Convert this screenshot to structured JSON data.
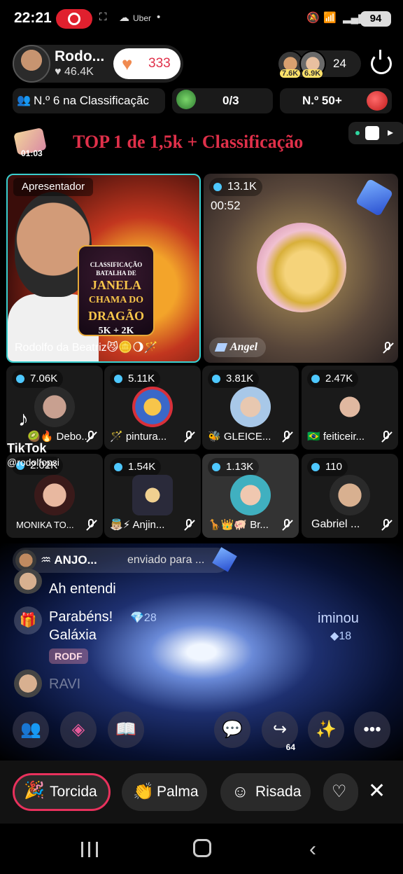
{
  "status": {
    "time": "22:21",
    "carrier_label": "Uber",
    "battery": "94"
  },
  "host": {
    "name": "Rodo...",
    "likes": "46.4K",
    "follow_count": "333"
  },
  "viewers": {
    "badge1": "7.6K",
    "badge2": "6.9K",
    "count": "24"
  },
  "ranking": {
    "rank_label": "N.º 6 na Classificaçãc",
    "progress": "0/3",
    "rank2_label": "N.º 50+"
  },
  "banner": {
    "timer": "01:03",
    "title": "TOP 1 de 1,5k + Classificação"
  },
  "host_tile": {
    "role": "Apresentador",
    "poster_small": "CLASSIFICAÇÃO",
    "poster_l1": "BATALHA DE",
    "poster_l2": "JANELA",
    "poster_l3": "CHAMA DO",
    "poster_l4": "DRAGÃO",
    "poster_l5": "5K + 2K",
    "label": "Rodolfo da Beatriz😼🪙🌖🪄"
  },
  "guest_tile": {
    "views": "13.1K",
    "timer": "00:52",
    "label": "Angel"
  },
  "small_tiles": [
    {
      "views": "7.06K",
      "name": "🥝🔥 Debo..."
    },
    {
      "views": "5.11K",
      "name": "🪄 pintura..."
    },
    {
      "views": "3.81K",
      "name": "🐝 GLEICE..."
    },
    {
      "views": "2.47K",
      "name": "🇧🇷 feiticeir..."
    },
    {
      "views": "2.02K",
      "name": "MONIKA TO..."
    },
    {
      "views": "1.54K",
      "name": "👼🏼⚡ Anjin..."
    },
    {
      "views": "1.13K",
      "name": "🦒👑🐖 Br..."
    },
    {
      "views": "110",
      "name": "Gabriel ..."
    }
  ],
  "watermark": {
    "brand": "TikTok",
    "handle": "@rodolfopsi"
  },
  "chat": {
    "gift_user": "♒ ANJO...",
    "gift_text": "enviado para ...",
    "msg1": "Ah entendi",
    "sys_line1": "Parabéns!",
    "sys_line2": "Galáxia",
    "sys_gem": "28",
    "sys_right": "iminou",
    "sys_right_gem": "18",
    "rodf_tag": "RODF",
    "partial_user": "RAVI"
  },
  "actions": {
    "share_count": "64"
  },
  "reactions": [
    {
      "label": "Torcida"
    },
    {
      "label": "Palma"
    },
    {
      "label": "Risada"
    }
  ]
}
